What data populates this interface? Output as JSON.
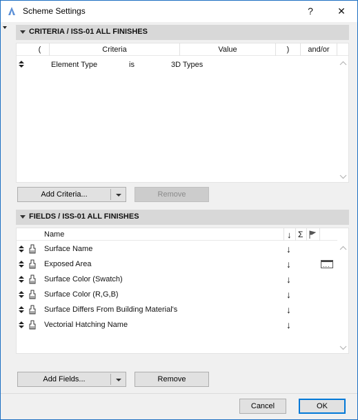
{
  "window": {
    "title": "Scheme Settings",
    "help_label": "?",
    "close_label": "✕"
  },
  "criteria_section": {
    "title": "CRITERIA / ISS-01 ALL FINISHES",
    "columns": [
      "(",
      "Criteria",
      "Value",
      ")",
      "and/or"
    ],
    "rows": [
      {
        "paren_open": "",
        "criteria": "Element Type",
        "operator": "is",
        "value": "3D Types",
        "paren_close": "",
        "andor": ""
      }
    ],
    "add_button": "Add Criteria...",
    "remove_button": "Remove"
  },
  "fields_section": {
    "title": "FIELDS / ISS-01 ALL FINISHES",
    "columns": {
      "name": "Name",
      "sort": "↓",
      "sum": "Σ",
      "flag": "flag-icon"
    },
    "rows": [
      {
        "name": "Surface Name",
        "sort": "↓",
        "has_more": false
      },
      {
        "name": "Exposed Area",
        "sort": "↓",
        "has_more": true
      },
      {
        "name": "Surface Color (Swatch)",
        "sort": "↓",
        "has_more": false
      },
      {
        "name": "Surface Color (R,G,B)",
        "sort": "↓",
        "has_more": false
      },
      {
        "name": "Surface Differs From Building Material's",
        "sort": "↓",
        "has_more": false
      },
      {
        "name": "Vectorial Hatching Name",
        "sort": "↓",
        "has_more": false
      }
    ],
    "add_button": "Add Fields...",
    "remove_button": "Remove"
  },
  "footer": {
    "cancel_button": "Cancel",
    "ok_button": "OK"
  },
  "colors": {
    "accent": "#0078d7",
    "window_border": "#1b6ec2",
    "section_header_bg": "#d8d8d8"
  }
}
